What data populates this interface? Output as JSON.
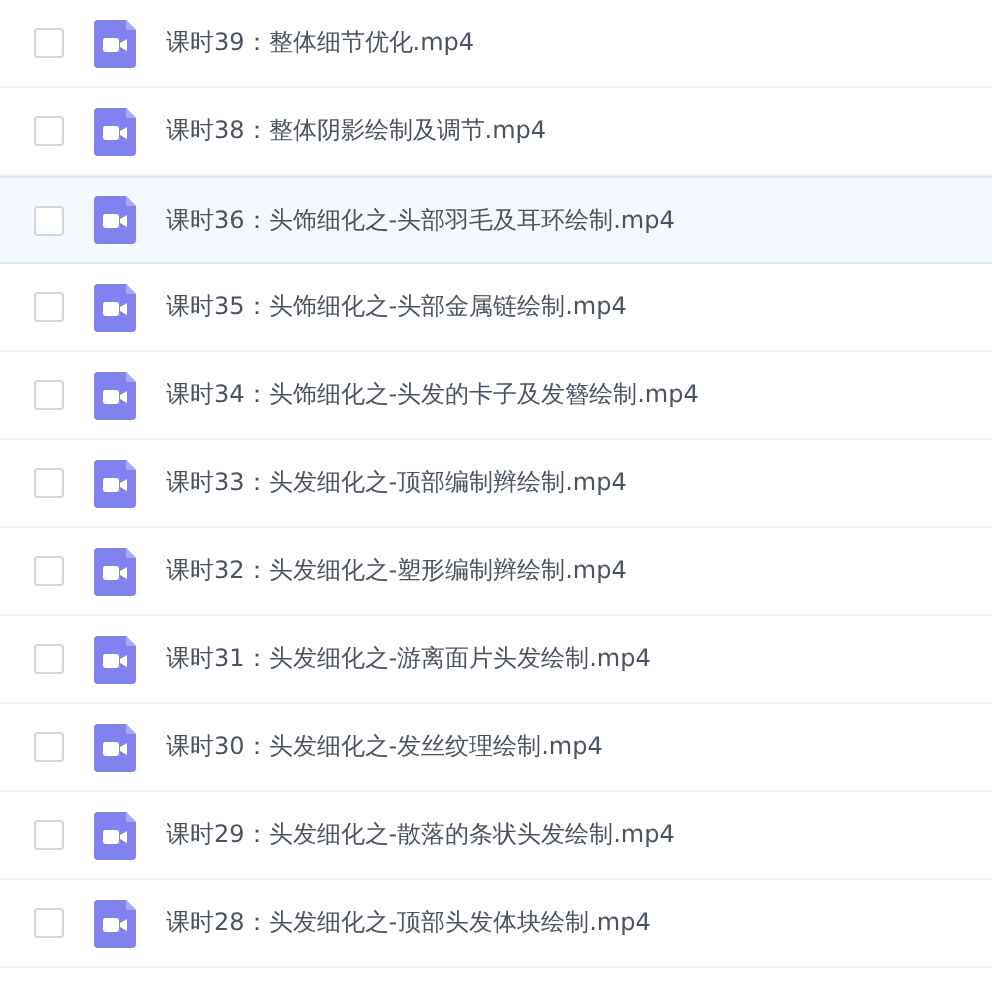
{
  "files": [
    {
      "name": "课时39：整体细节优化.mp4",
      "checked": false,
      "hovered": false
    },
    {
      "name": "课时38：整体阴影绘制及调节.mp4",
      "checked": false,
      "hovered": false
    },
    {
      "name": "课时36：头饰细化之-头部羽毛及耳环绘制.mp4",
      "checked": false,
      "hovered": true
    },
    {
      "name": "课时35：头饰细化之-头部金属链绘制.mp4",
      "checked": false,
      "hovered": false
    },
    {
      "name": "课时34：头饰细化之-头发的卡子及发簪绘制.mp4",
      "checked": false,
      "hovered": false
    },
    {
      "name": "课时33：头发细化之-顶部编制辫绘制.mp4",
      "checked": false,
      "hovered": false
    },
    {
      "name": "课时32：头发细化之-塑形编制辫绘制.mp4",
      "checked": false,
      "hovered": false
    },
    {
      "name": "课时31：头发细化之-游离面片头发绘制.mp4",
      "checked": false,
      "hovered": false
    },
    {
      "name": "课时30：头发细化之-发丝纹理绘制.mp4",
      "checked": false,
      "hovered": false
    },
    {
      "name": "课时29：头发细化之-散落的条状头发绘制.mp4",
      "checked": false,
      "hovered": false
    },
    {
      "name": "课时28：头发细化之-顶部头发体块绘制.mp4",
      "checked": false,
      "hovered": false
    }
  ]
}
